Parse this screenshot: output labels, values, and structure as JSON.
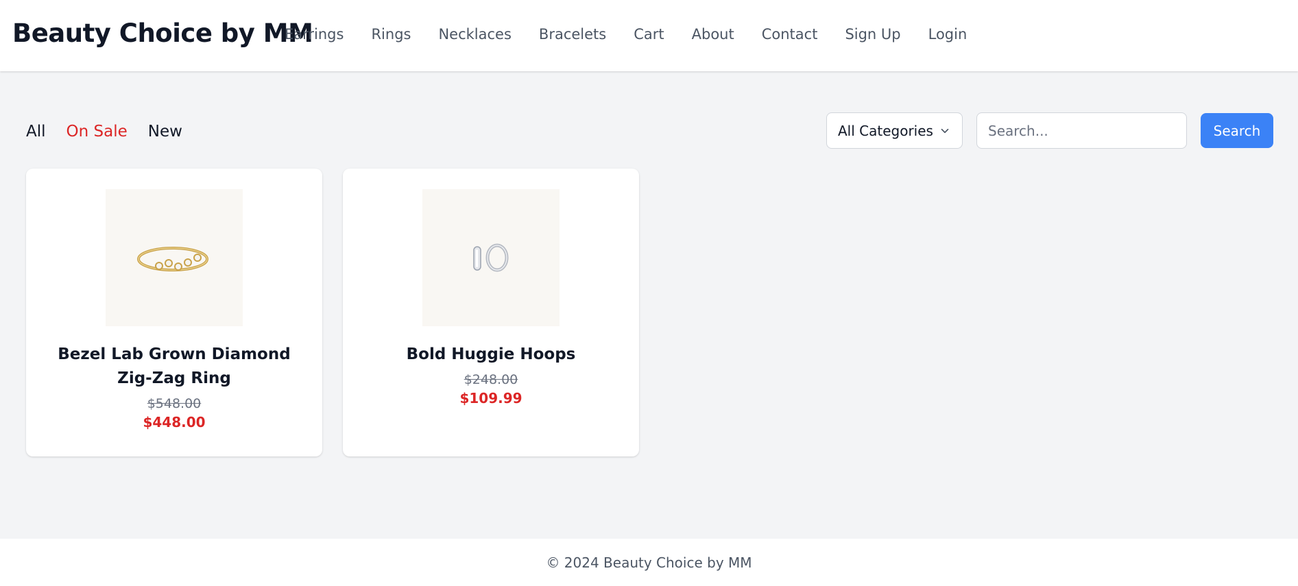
{
  "header": {
    "brand": "Beauty Choice by MM",
    "nav": [
      "Earrings",
      "Rings",
      "Necklaces",
      "Bracelets",
      "Cart",
      "About",
      "Contact",
      "Sign Up",
      "Login"
    ]
  },
  "filters": {
    "tabs": [
      {
        "label": "All",
        "active": false
      },
      {
        "label": "On Sale",
        "active": true
      },
      {
        "label": "New",
        "active": false
      }
    ],
    "category_select": {
      "selected": "All Categories",
      "icon": "chevron-down-icon"
    },
    "search": {
      "placeholder": "Search...",
      "value": "",
      "button_label": "Search"
    }
  },
  "products": [
    {
      "name": "Bezel Lab Grown Diamond Zig-Zag Ring",
      "old_price": "$548.00",
      "price": "$448.00",
      "image": "gold-ring-image"
    },
    {
      "name": "Bold Huggie Hoops",
      "old_price": "$248.00",
      "price": "$109.99",
      "image": "silver-hoops-image"
    }
  ],
  "footer": {
    "text": "© 2024 Beauty Choice by MM"
  },
  "colors": {
    "accent": "#3b82f6",
    "sale": "#dc2626",
    "background": "#f3f4f6"
  }
}
